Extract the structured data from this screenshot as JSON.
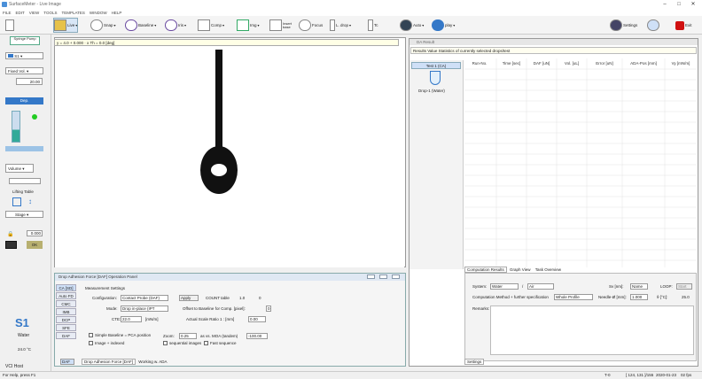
{
  "window": {
    "title": "SurfaceMeter - Live Image",
    "min": "–",
    "max": "□",
    "close": "✕"
  },
  "menu": [
    "FILE",
    "EDIT",
    "VIEW",
    "TOOLS",
    "TEMPLATES",
    "WINDOW",
    "HELP"
  ],
  "toolbar": {
    "live": "Live",
    "snap": "Snap",
    "baseline": "Baseline",
    "iris": "Iris",
    "comp": "Comp",
    "img": "Img",
    "insert": "Insert base",
    "focus": "Focus",
    "drop": "L. drop",
    "tilt": "Tc",
    "auto": "Auto",
    "play": "play",
    "settings": "Settings",
    "exit": "Exit"
  },
  "left": {
    "syringe": "Syringe Pump",
    "sel1": "S1",
    "fixed": "Fixed Vol.",
    "vol": "20.00",
    "dose": "Dep.",
    "volume_label": "Volume",
    "lifting": "Lifting Table",
    "stage": "Stage",
    "val": "0.000",
    "ok": "OK",
    "sample": "S1",
    "liquid": "Water",
    "temp": "24.0 °C",
    "status": "VCI Host"
  },
  "fit_line": "y = 4.0 + 0.000 · x   Th = 0.0 [deg]",
  "op": {
    "title": "Drop Adhesion Force [DAF] Operation Panel",
    "tabs": [
      "CA [SD]",
      "Auto FD",
      "CMC",
      "IMB",
      "DCP",
      "SFE",
      "DAF"
    ],
    "section": "Measurement Settings",
    "config_label": "Configuration:",
    "config_val": "Contact Probe (DAF)",
    "apply": "Apply",
    "count_label": "COUNT table",
    "count_val": "1.0",
    "count_val2": "0",
    "mode_label": "Mode:",
    "mode_val": "Drop in-place (IPT",
    "offset_label": "Offset to Baseline for Comp. [pixel]:",
    "offset_val": "0",
    "cte_label": "CTE:",
    "cte_val": "22.0",
    "cte_unit": "[mN/m]",
    "scale_label": "Actual Scale Ratio 1 : [mm]",
    "scale_val": "0.00",
    "simple": "Simple Baseline = PCA position",
    "zoom_label": "Zoom:",
    "zoom_val": "0.25",
    "stage_label": "as vs. MOA (tandem)",
    "stage_val": "-100.00",
    "images": "Image + indexed",
    "seq": "sequential images",
    "seq2": "Fast sequence",
    "bottom_tabs": [
      "Drop Adhesion Force [DAF]",
      "Working w. ADA"
    ],
    "daf": "DAF"
  },
  "right": {
    "title": "DA Result",
    "banner": "Results Value Statistics of currently selected drops/test",
    "test": "Test 1 (CA)",
    "drop": "Drop-1 (Water)",
    "columns": [
      "Run-No.",
      "Time [sec]",
      "DAF [uN]",
      "Vol. [uL]",
      "Error [uN]",
      "ADA-Pos [mm]",
      "Vy [mN/m]"
    ],
    "tabs": [
      "Computation Results",
      "Graph View",
      "Task Overview"
    ],
    "system_label": "System:",
    "system_val": "Water",
    "slash": "/",
    "air": "Air",
    "sv_label": "Sv [nm]:",
    "sv_val": "Name",
    "loop_label": "LOOP:",
    "loop_val": "Start",
    "method_label": "Computation Method + further specification",
    "method_val": "Whole Profile",
    "needle_label": "Needle-Ø [mm]:",
    "needle_val": "1.000",
    "t_label": "ϑ [°C]:",
    "t_val": "25.0",
    "remarks": "Remarks:",
    "settings_tab": "Settings"
  },
  "status": {
    "help": "For Help, press F1",
    "coords": "T-0",
    "c2": "[ 124, 131 ]/155",
    "c3": "2020-01-23",
    "c4": "00:00:00",
    "fps": "02 fps"
  },
  "colors": {
    "accent": "#3478c8",
    "exit": "#d01010",
    "selected": "#cfe0f7"
  }
}
